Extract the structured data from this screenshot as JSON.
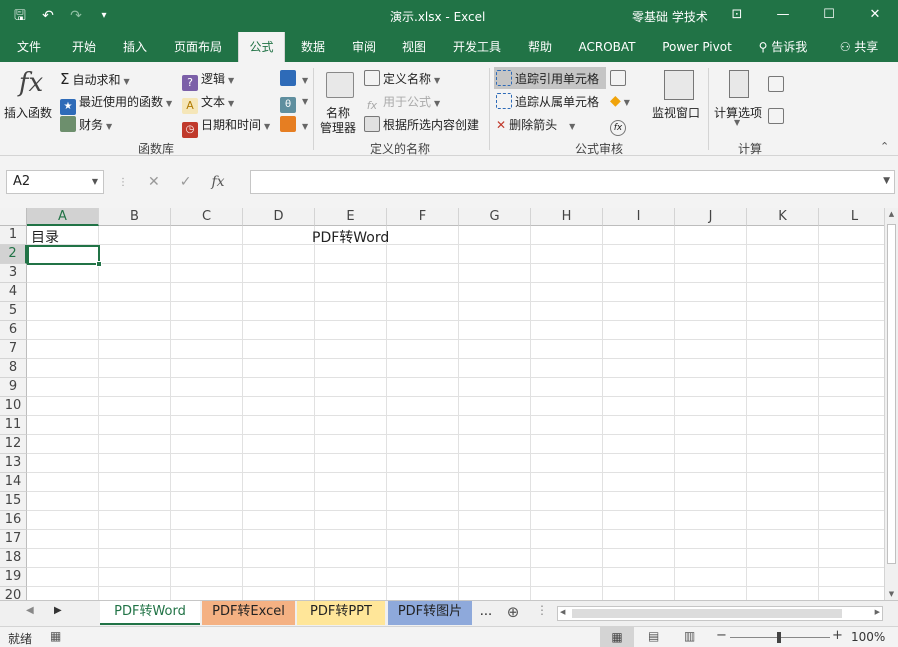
{
  "window": {
    "title": "演示.xlsx  -  Excel",
    "account": "零基础 学技术"
  },
  "tabs": [
    {
      "label": "文件"
    },
    {
      "label": "开始"
    },
    {
      "label": "插入"
    },
    {
      "label": "页面布局"
    },
    {
      "label": "公式"
    },
    {
      "label": "数据"
    },
    {
      "label": "审阅"
    },
    {
      "label": "视图"
    },
    {
      "label": "开发工具"
    },
    {
      "label": "帮助"
    },
    {
      "label": "ACROBAT"
    },
    {
      "label": "Power Pivot"
    },
    {
      "label": "告诉我"
    },
    {
      "label": "共享"
    }
  ],
  "ribbon": {
    "insert_function": "插入函数",
    "autosum": "自动求和",
    "recent": "最近使用的函数",
    "financial": "财务",
    "logical": "逻辑",
    "text": "文本",
    "datetime": "日期和时间",
    "group_library": "函数库",
    "name_manager_1": "名称",
    "name_manager_2": "管理器",
    "define_name": "定义名称",
    "use_in_formula": "用于公式",
    "create_from_selection": "根据所选内容创建",
    "group_names": "定义的名称",
    "trace_precedents": "追踪引用单元格",
    "trace_dependents": "追踪从属单元格",
    "remove_arrows": "删除箭头",
    "group_auditing": "公式审核",
    "watch_window": "监视窗口",
    "calc_options": "计算选项",
    "group_calc": "计算"
  },
  "formula_bar": {
    "name_box": "A2",
    "fx": "fx",
    "value": ""
  },
  "columns": [
    "A",
    "B",
    "C",
    "D",
    "E",
    "F",
    "G",
    "H",
    "I",
    "J",
    "K",
    "L"
  ],
  "rows": [
    "1",
    "2",
    "3",
    "4",
    "5",
    "6",
    "7",
    "8",
    "9",
    "10",
    "11",
    "12",
    "13",
    "14",
    "15",
    "16",
    "17",
    "18",
    "19",
    "20"
  ],
  "cells": {
    "A1": "目录",
    "E1": "PDF转Word"
  },
  "sheets": [
    {
      "label": "PDF转Word",
      "color": "#ffffff"
    },
    {
      "label": "PDF转Excel",
      "color": "#f4b183"
    },
    {
      "label": "PDF转PPT",
      "color": "#ffe699"
    },
    {
      "label": "PDF转图片",
      "color": "#8ea9db"
    }
  ],
  "sheet_more": "...",
  "status": {
    "ready": "就绪",
    "zoom": "100%"
  },
  "colors": {
    "accent": "#217346"
  }
}
